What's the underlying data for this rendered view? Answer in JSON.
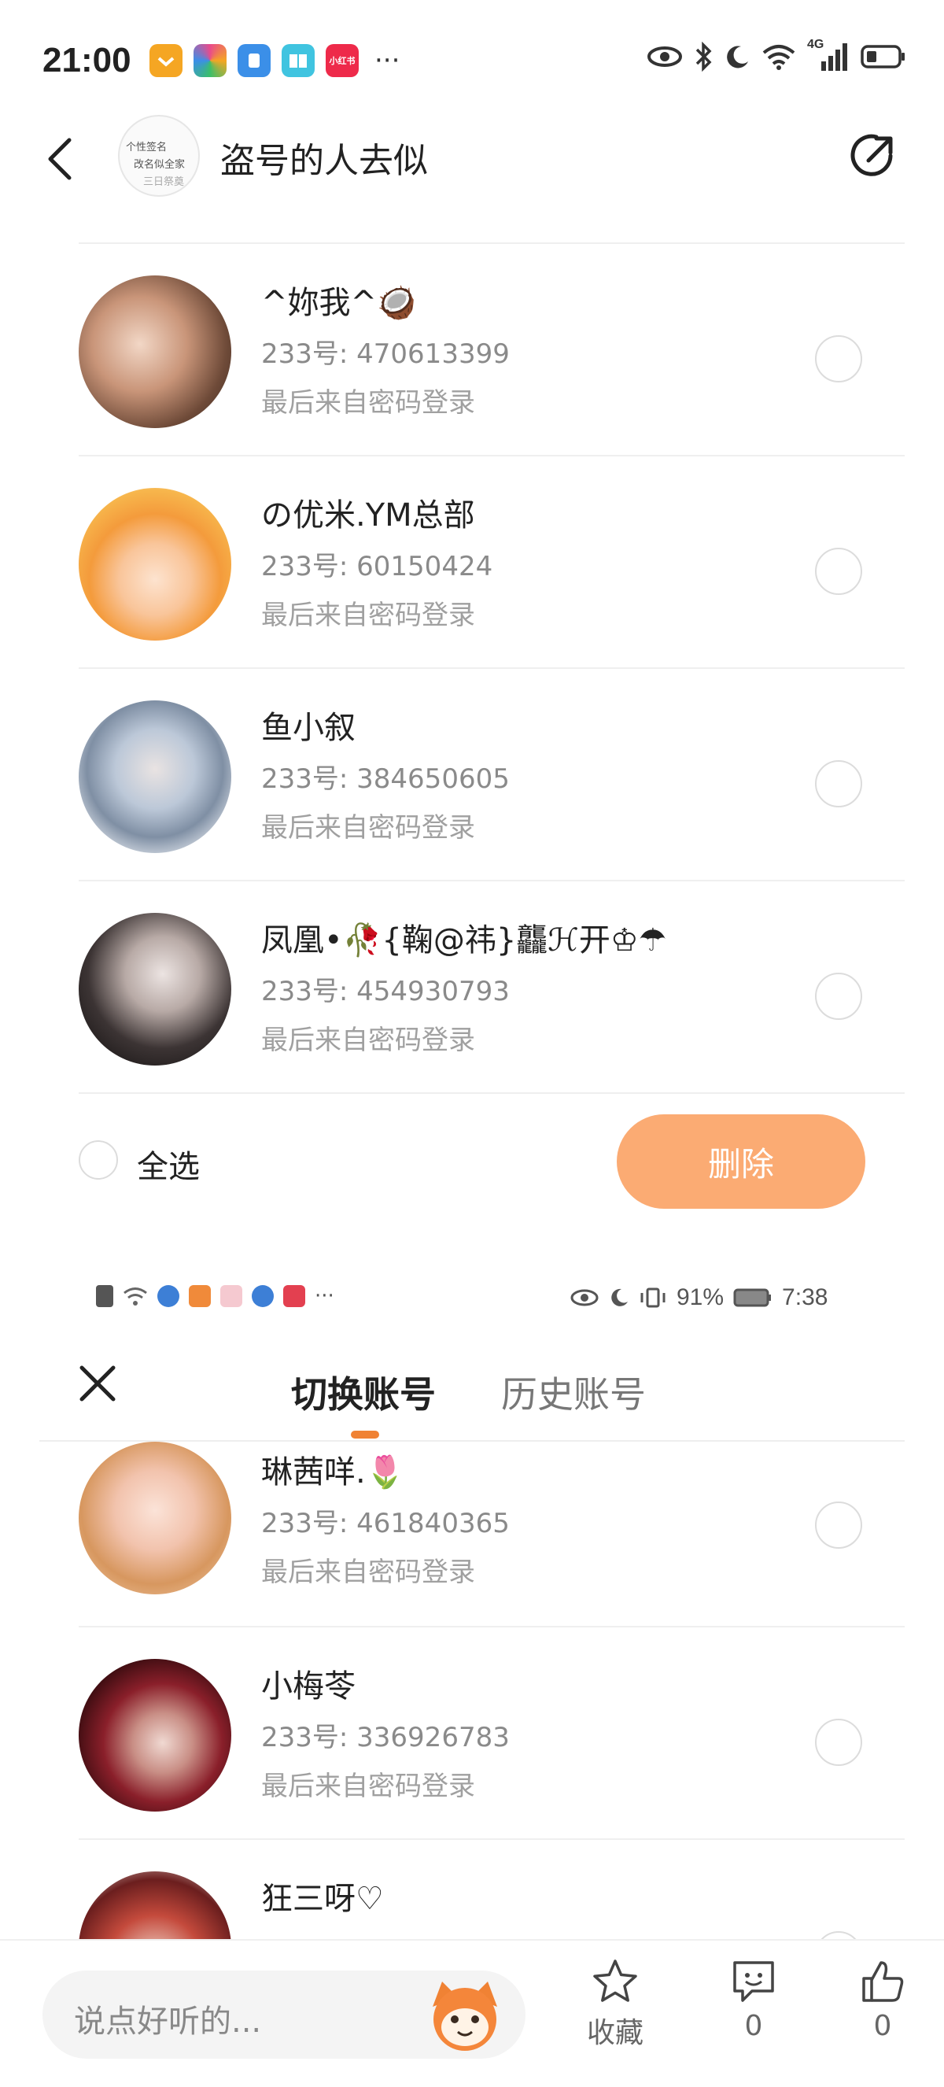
{
  "status_bar": {
    "time": "21:00",
    "apps": [
      {
        "icon": "app-icon-1",
        "color": "#f5a623"
      },
      {
        "icon": "app-icon-2",
        "color": "#e94b8b"
      },
      {
        "icon": "app-icon-3",
        "color": "#3b8fe8"
      },
      {
        "icon": "app-icon-4",
        "color": "#40c4e0"
      },
      {
        "icon": "xiaohongshu-icon",
        "color": "#ee2a4a",
        "text": "小红书"
      }
    ],
    "more": "···",
    "network": "4G"
  },
  "header": {
    "title": "盗号的人去似",
    "group_avatar_lines": [
      "个性签名",
      "改名似全家",
      "三日祭奠"
    ]
  },
  "accounts_top": [
    {
      "name": "^妳我^🥥",
      "id": "233号: 470613399",
      "login": "最后来自密码登录"
    },
    {
      "name": "の优米.YM总部",
      "id": "233号: 60150424",
      "login": "最后来自密码登录"
    },
    {
      "name": "鱼小叙",
      "id": "233号: 384650605",
      "login": "最后来自密码登录"
    },
    {
      "name": "凤凰•🥀{鞠@祎}龘ℋ开♔☂",
      "id": "233号: 454930793",
      "login": "最后来自密码登录"
    }
  ],
  "select_bar": {
    "select_all": "全选",
    "delete": "删除"
  },
  "status_bar_2": {
    "battery": "91%",
    "time": "7:38",
    "more": "···"
  },
  "switch_panel": {
    "tab_switch": "切换账号",
    "tab_history": "历史账号"
  },
  "accounts_bottom": [
    {
      "name": "琳茜咩.🌷",
      "id": "233号: 461840365",
      "login": "最后来自密码登录"
    },
    {
      "name": "小梅苓",
      "id": "233号: 336926783",
      "login": "最后来自密码登录"
    },
    {
      "name": "狂三呀♡",
      "id": "",
      "login": ""
    }
  ],
  "bottom_bar": {
    "placeholder": "说点好听的...",
    "favorite": "收藏",
    "comments": "0",
    "likes": "0"
  },
  "colors": {
    "accent": "#f08234",
    "delete_button": "#fbab73"
  }
}
